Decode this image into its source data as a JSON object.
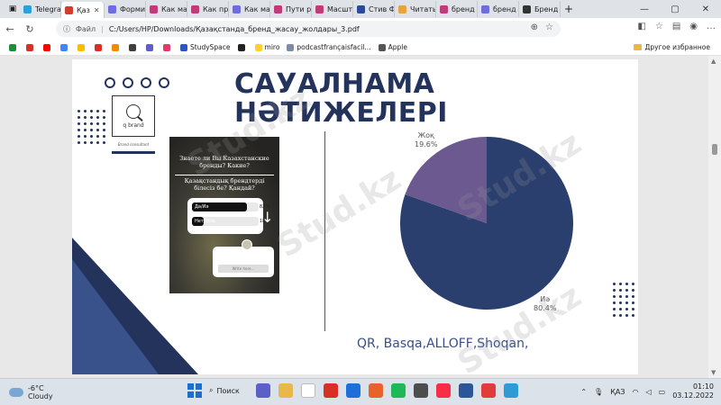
{
  "browser": {
    "tabs": [
      {
        "label": "Telegra",
        "color": "#2aa1da"
      },
      {
        "label": "Қаз",
        "color": "#d33b2c",
        "active": true
      },
      {
        "label": "Форми",
        "color": "#6d6de0"
      },
      {
        "label": "Как ма",
        "color": "#c23a7a"
      },
      {
        "label": "Как пр",
        "color": "#c23a7a"
      },
      {
        "label": "Как ма",
        "color": "#6d6de0"
      },
      {
        "label": "Пути р",
        "color": "#c23a7a"
      },
      {
        "label": "Масшт",
        "color": "#c23a7a"
      },
      {
        "label": "Стив Ф",
        "color": "#2b4a9a"
      },
      {
        "label": "Читать",
        "color": "#e8a33a"
      },
      {
        "label": "бренд",
        "color": "#c23a7a"
      },
      {
        "label": "бренд",
        "color": "#6d6de0"
      },
      {
        "label": "Бренд",
        "color": "#333333"
      }
    ],
    "new_tab": "+",
    "address": {
      "scheme_label": "Файл",
      "path": "C:/Users/HP/Downloads/Қазақстанда_бренд_жасау_жолдары_3.pdf"
    },
    "bookmarks": [
      {
        "label": "",
        "color": "#1e8e3e"
      },
      {
        "label": "",
        "color": "#d93025"
      },
      {
        "label": "",
        "color": "#ff0000"
      },
      {
        "label": "",
        "color": "#4285f4"
      },
      {
        "label": "",
        "color": "#fbbc04"
      },
      {
        "label": "",
        "color": "#d93025"
      },
      {
        "label": "",
        "color": "#f28b00"
      },
      {
        "label": "",
        "color": "#3c4043"
      },
      {
        "label": "",
        "color": "#5b5fc7"
      },
      {
        "label": "",
        "color": "#e23b6a"
      },
      {
        "label": "StudySpace",
        "color": "#2a56c6"
      },
      {
        "label": "",
        "color": "#222222"
      },
      {
        "label": "miro",
        "color": "#ffd02f"
      },
      {
        "label": "podcastfrançaisfacil...",
        "color": "#7a8ca8"
      },
      {
        "label": "Apple",
        "color": "#555555"
      }
    ],
    "other_bookmarks": "Другое избранное"
  },
  "slide": {
    "title_line1": "САУАЛНАМА",
    "title_line2": "НӘТИЖЕЛЕРІ",
    "logo_name": "q brand",
    "logo_sub": "Brand consultant",
    "phone": {
      "question1": "Знаете ли Вы Казахстанские бренды? Какие?",
      "question2": "Қазақстандық брендтерді білесіз бе? Қандай?",
      "options": [
        {
          "label": "Да/Иә",
          "percent": "82%",
          "fill": 0.82
        },
        {
          "label": "Нет/Жоқ",
          "percent": "18%",
          "fill": 0.18
        }
      ],
      "reply_placeholder": "Write here..."
    },
    "answer_text": "QR, Basqa,ALLOFF,Shoqan,"
  },
  "chart_data": {
    "type": "pie",
    "slices": [
      {
        "label": "Иә",
        "value": 80.4,
        "display": "80.4%",
        "color": "#2b3f6e"
      },
      {
        "label": "Жоқ",
        "value": 19.6,
        "display": "19.6%",
        "color": "#6b5990"
      }
    ]
  },
  "watermark": "Stud.kz",
  "taskbar": {
    "temperature": "-6°C",
    "condition": "Cloudy",
    "search_label": "Поиск",
    "language": "ҚАЗ",
    "time": "01:10",
    "date": "03.12.2022",
    "apps": [
      "#5b5fc7",
      "#e8b84a",
      "#ffffff",
      "#d93025",
      "#1e6fd9",
      "#e8622a",
      "#1db954",
      "#4d4d4d",
      "#fa2d48",
      "#2b579a",
      "#e23b3b",
      "#2e9bd6"
    ]
  }
}
